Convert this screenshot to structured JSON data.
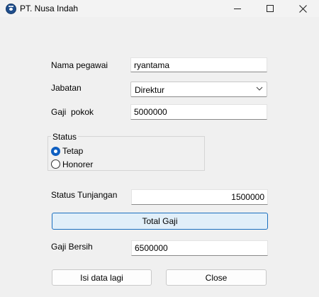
{
  "window": {
    "title": "PT. Nusa Indah",
    "icon": "paw-icon"
  },
  "form": {
    "nama_label": "Nama pegawai",
    "nama_value": "ryantama",
    "jabatan_label": "Jabatan",
    "jabatan_value": "Direktur",
    "gaji_pokok_label": "Gaji  pokok",
    "gaji_pokok_value": "5000000",
    "status_group_label": "Status",
    "status_options": [
      {
        "label": "Tetap",
        "checked": true
      },
      {
        "label": "Honorer",
        "checked": false
      }
    ],
    "tunjangan_label": "Status Tunjangan",
    "tunjangan_value": "1500000",
    "total_button": "Total Gaji",
    "gaji_bersih_label": "Gaji Bersih",
    "gaji_bersih_value": "6500000",
    "isi_button": "Isi data lagi",
    "close_button": "Close"
  },
  "colors": {
    "accent": "#0e5fc1",
    "focused_button_bg": "#e1eff9",
    "window_bg": "#f0f0f0"
  }
}
